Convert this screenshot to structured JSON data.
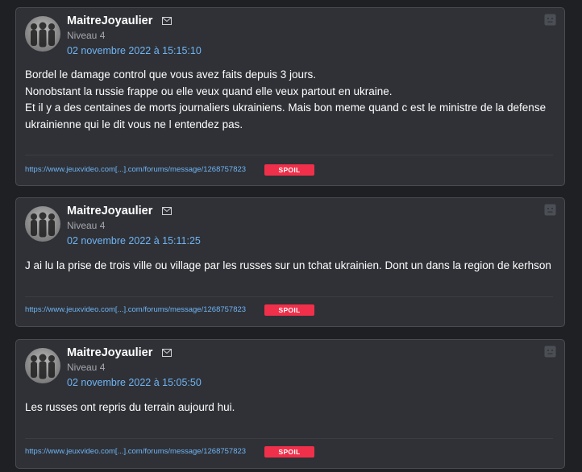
{
  "posts": [
    {
      "author": "MaitreJoyaulier",
      "level": "Niveau 4",
      "date": "02 novembre 2022 à 15:15:10",
      "body_lines": [
        "Bordel le damage control que vous avez faits depuis 3 jours.",
        "Nonobstant la russie frappe ou elle veux quand elle veux partout en ukraine.",
        "Et il y a des centaines de morts journaliers ukrainiens. Mais bon meme quand c est le ministre de la defense ukrainienne qui le dit vous ne l entendez pas."
      ],
      "permalink": "https://www.jeuxvideo.com[...].com/forums/message/1268757823",
      "spoil_label": "SPOIL"
    },
    {
      "author": "MaitreJoyaulier",
      "level": "Niveau 4",
      "date": "02 novembre 2022 à 15:11:25",
      "body_lines": [
        "J ai lu la prise de trois ville ou village par les russes sur un tchat ukrainien. Dont un dans la region de kerhson"
      ],
      "permalink": "https://www.jeuxvideo.com[...].com/forums/message/1268757823",
      "spoil_label": "SPOIL"
    },
    {
      "author": "MaitreJoyaulier",
      "level": "Niveau 4",
      "date": "02 novembre 2022 à 15:05:50",
      "body_lines": [
        "Les russes ont repris du terrain aujourd hui."
      ],
      "permalink": "https://www.jeuxvideo.com[...].com/forums/message/1268757823",
      "spoil_label": "SPOIL"
    }
  ],
  "icons": {
    "avatar": "avatar-three-figures",
    "mail": "envelope-icon",
    "report": "smiley-icon"
  },
  "colors": {
    "background": "#1f2024",
    "card": "#2f3136",
    "card_border": "#4a4c52",
    "link": "#6fb4f5",
    "spoil": "#f0304a"
  }
}
